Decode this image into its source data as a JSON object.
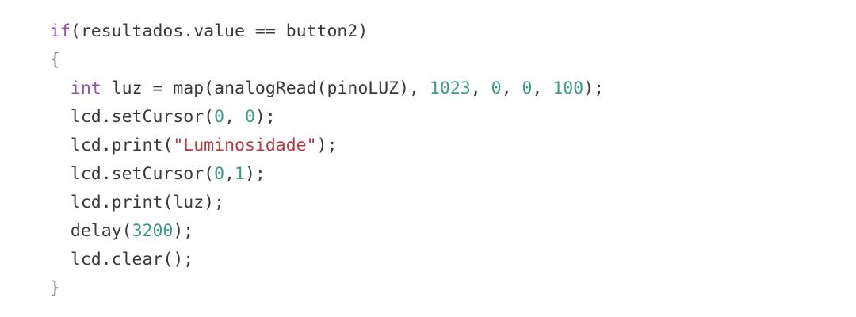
{
  "code": {
    "lines": [
      {
        "tokens": [
          {
            "t": "if",
            "k": "kw"
          },
          {
            "t": "(resultados.value == button2)",
            "k": "txt"
          }
        ]
      },
      {
        "tokens": [
          {
            "t": "{",
            "k": "brace"
          }
        ]
      },
      {
        "tokens": [
          {
            "t": "  ",
            "k": "txt"
          },
          {
            "t": "int",
            "k": "kw"
          },
          {
            "t": " luz = map(analogRead(pinoLUZ), ",
            "k": "txt"
          },
          {
            "t": "1023",
            "k": "num"
          },
          {
            "t": ", ",
            "k": "txt"
          },
          {
            "t": "0",
            "k": "num"
          },
          {
            "t": ", ",
            "k": "txt"
          },
          {
            "t": "0",
            "k": "num"
          },
          {
            "t": ", ",
            "k": "txt"
          },
          {
            "t": "100",
            "k": "num"
          },
          {
            "t": ");",
            "k": "txt"
          }
        ]
      },
      {
        "tokens": [
          {
            "t": "  lcd.setCursor(",
            "k": "txt"
          },
          {
            "t": "0",
            "k": "num"
          },
          {
            "t": ", ",
            "k": "txt"
          },
          {
            "t": "0",
            "k": "num"
          },
          {
            "t": ");",
            "k": "txt"
          }
        ]
      },
      {
        "tokens": [
          {
            "t": "  lcd.print(",
            "k": "txt"
          },
          {
            "t": "\"Luminosidade\"",
            "k": "str"
          },
          {
            "t": ");",
            "k": "txt"
          }
        ]
      },
      {
        "tokens": [
          {
            "t": "  lcd.setCursor(",
            "k": "txt"
          },
          {
            "t": "0",
            "k": "num"
          },
          {
            "t": ",",
            "k": "txt"
          },
          {
            "t": "1",
            "k": "num"
          },
          {
            "t": ");",
            "k": "txt"
          }
        ]
      },
      {
        "tokens": [
          {
            "t": "  lcd.print(luz);",
            "k": "txt"
          }
        ]
      },
      {
        "tokens": [
          {
            "t": "  delay(",
            "k": "txt"
          },
          {
            "t": "3200",
            "k": "num"
          },
          {
            "t": ");",
            "k": "txt"
          }
        ]
      },
      {
        "tokens": [
          {
            "t": "  lcd.clear();",
            "k": "txt"
          }
        ]
      },
      {
        "tokens": [
          {
            "t": "}",
            "k": "brace"
          }
        ]
      }
    ]
  }
}
